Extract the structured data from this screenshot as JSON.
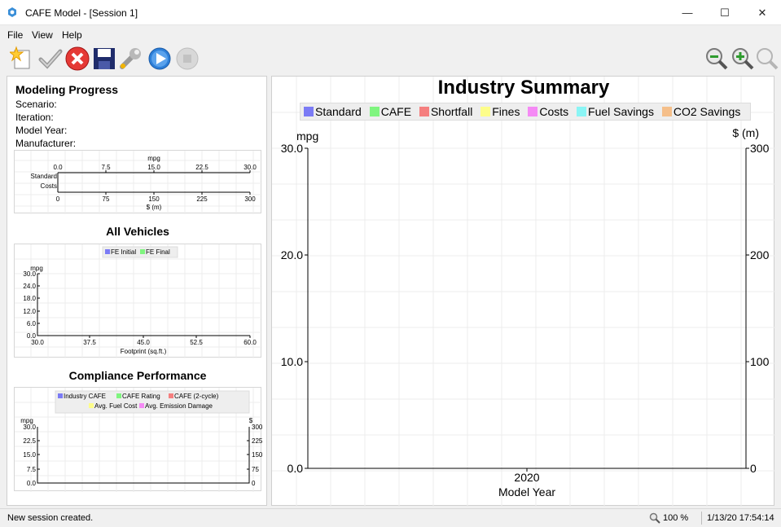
{
  "window": {
    "title": "CAFE Model - [Session 1]",
    "minimize": "—",
    "maximize": "☐",
    "close": "✕"
  },
  "menu": [
    "File",
    "View",
    "Help"
  ],
  "toolbar": {
    "left": [
      "new-session-icon",
      "check-icon",
      "stop-icon",
      "save-icon",
      "settings-wrench-icon",
      "run-icon",
      "stop-model-icon"
    ],
    "right": [
      "zoom-out-icon",
      "zoom-in-icon",
      "zoom-reset-icon"
    ]
  },
  "modeling_progress": {
    "title": "Modeling Progress",
    "labels": {
      "scenario": "Scenario:",
      "iteration": "Iteration:",
      "model_year": "Model Year:",
      "manufacturer": "Manufacturer:"
    },
    "chart": {
      "top_unit": "mpg",
      "bottom_unit": "$ (m)",
      "top_ticks": [
        "0.0",
        "7.5",
        "15.0",
        "22.5",
        "30.0"
      ],
      "bottom_ticks": [
        "0",
        "75",
        "150",
        "225",
        "300"
      ],
      "rows": [
        "Standard",
        "Costs"
      ]
    }
  },
  "all_vehicles": {
    "title": "All Vehicles",
    "legend": [
      {
        "label": "FE Initial",
        "color": "#7b7bf5"
      },
      {
        "label": "FE Final",
        "color": "#7ff57f"
      }
    ],
    "y_unit": "mpg",
    "y_ticks": [
      "30.0",
      "24.0",
      "18.0",
      "12.0",
      "6.0",
      "0.0"
    ],
    "x_ticks": [
      "30.0",
      "37.5",
      "45.0",
      "52.5",
      "60.0"
    ],
    "x_label": "Footprint (sq.ft.)"
  },
  "compliance_performance": {
    "title": "Compliance Performance",
    "legend_row1": [
      {
        "label": "Industry CAFE",
        "color": "#7b7bf5"
      },
      {
        "label": "CAFE Rating",
        "color": "#7ff57f"
      },
      {
        "label": "CAFE (2-cycle)",
        "color": "#f57f7f"
      }
    ],
    "legend_row2": [
      {
        "label": "Avg. Fuel Cost",
        "color": "#fdfd8a"
      },
      {
        "label": "Avg. Emission Damage",
        "color": "#f58af5"
      }
    ],
    "y_left_unit": "mpg",
    "y_right_unit": "$",
    "y_left_ticks": [
      "30.0",
      "22.5",
      "15.0",
      "7.5",
      "0.0"
    ],
    "y_right_ticks": [
      "300",
      "225",
      "150",
      "75",
      "0"
    ]
  },
  "industry_summary": {
    "title": "Industry Summary",
    "legend": [
      {
        "label": "Standard",
        "color": "#7b7bf5"
      },
      {
        "label": "CAFE",
        "color": "#7ff57f"
      },
      {
        "label": "Shortfall",
        "color": "#f57f7f"
      },
      {
        "label": "Fines",
        "color": "#fdfd8a"
      },
      {
        "label": "Costs",
        "color": "#f58af5"
      },
      {
        "label": "Fuel Savings",
        "color": "#8af5f5"
      },
      {
        "label": "CO2 Savings",
        "color": "#f5bf8a"
      }
    ],
    "y_left_unit": "mpg",
    "y_right_unit": "$ (m)",
    "y_left_ticks": [
      "30.0",
      "20.0",
      "10.0",
      "0.0"
    ],
    "y_right_ticks": [
      "300",
      "200",
      "100",
      "0"
    ],
    "x_ticks": [
      "2020"
    ],
    "x_label": "Model Year"
  },
  "status": {
    "message": "New session created.",
    "zoom": "100 %",
    "datetime": "1/13/20 17:54:14"
  }
}
